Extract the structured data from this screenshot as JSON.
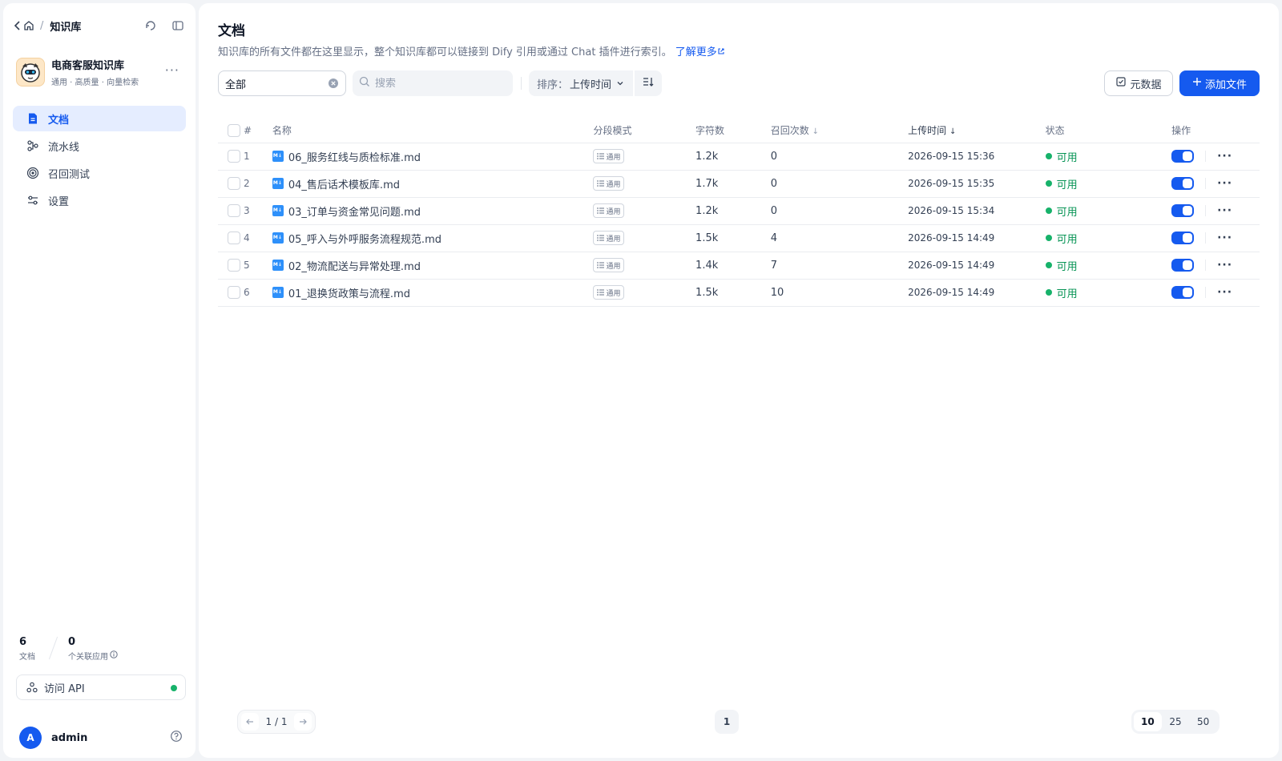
{
  "breadcrumb": {
    "current": "知识库",
    "separator": "/"
  },
  "knowledge_base": {
    "name": "电商客服知识库",
    "tags": "通用 · 高质量 · 向量检索"
  },
  "nav": [
    {
      "label": "文档",
      "icon": "document-icon",
      "active": true
    },
    {
      "label": "流水线",
      "icon": "pipeline-icon"
    },
    {
      "label": "召回测试",
      "icon": "target-icon"
    },
    {
      "label": "设置",
      "icon": "settings-icon"
    }
  ],
  "stats": {
    "documents": {
      "value": "6",
      "label": "文档"
    },
    "apps": {
      "value": "0",
      "label": "个关联应用"
    }
  },
  "api_button": {
    "label": "访问 API"
  },
  "user": {
    "initial": "A",
    "name": "admin"
  },
  "page": {
    "title": "文档",
    "description": "知识库的所有文件都在这里显示，整个知识库都可以链接到 Dify 引用或通过 Chat 插件进行索引。",
    "learn_more": "了解更多"
  },
  "toolbar": {
    "filter_value": "全部",
    "search_placeholder": "搜索",
    "sort_label": "排序：",
    "sort_value": "上传时间",
    "metadata_label": "元数据",
    "add_label": "添加文件"
  },
  "table": {
    "headers": {
      "index": "#",
      "name": "名称",
      "mode": "分段模式",
      "chars": "字符数",
      "hits": "召回次数",
      "time": "上传时间",
      "status": "状态",
      "ops": "操作"
    },
    "rows": [
      {
        "index": "1",
        "name": "06_服务红线与质检标准.md",
        "mode": "通用",
        "chars": "1.2k",
        "hits": "0",
        "time": "2026-09-15 15:36",
        "status": "可用"
      },
      {
        "index": "2",
        "name": "04_售后话术模板库.md",
        "mode": "通用",
        "chars": "1.7k",
        "hits": "0",
        "time": "2026-09-15 15:35",
        "status": "可用"
      },
      {
        "index": "3",
        "name": "03_订单与资金常见问题.md",
        "mode": "通用",
        "chars": "1.2k",
        "hits": "0",
        "time": "2026-09-15 15:34",
        "status": "可用"
      },
      {
        "index": "4",
        "name": "05_呼入与外呼服务流程规范.md",
        "mode": "通用",
        "chars": "1.5k",
        "hits": "4",
        "time": "2026-09-15 14:49",
        "status": "可用"
      },
      {
        "index": "5",
        "name": "02_物流配送与异常处理.md",
        "mode": "通用",
        "chars": "1.4k",
        "hits": "7",
        "time": "2026-09-15 14:49",
        "status": "可用"
      },
      {
        "index": "6",
        "name": "01_退换货政策与流程.md",
        "mode": "通用",
        "chars": "1.5k",
        "hits": "10",
        "time": "2026-09-15 14:49",
        "status": "可用"
      }
    ]
  },
  "pagination": {
    "range": "1 / 1",
    "current_page": "1",
    "sizes": [
      "10",
      "25",
      "50"
    ],
    "selected_size": "10"
  },
  "colors": {
    "accent": "#155aef",
    "success": "#17b26a"
  }
}
